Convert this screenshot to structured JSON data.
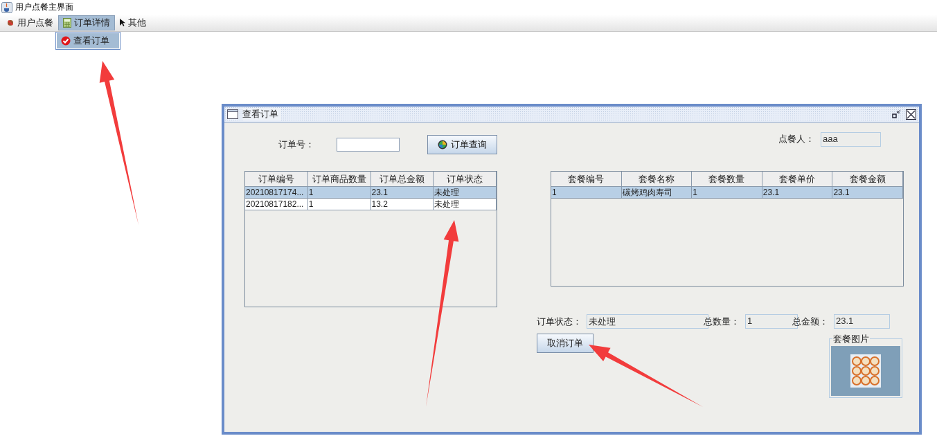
{
  "window": {
    "title": "用户点餐主界面"
  },
  "menu": [
    {
      "label": "用户点餐",
      "selected": false
    },
    {
      "label": "订单详情",
      "selected": true
    },
    {
      "label": "其他",
      "selected": false
    }
  ],
  "dropdown": [
    {
      "label": "查看订单",
      "selected": true
    }
  ],
  "dialog": {
    "title": "查看订单",
    "order_no": {
      "label": "订单号："
    },
    "query_button": "订单查询",
    "customer": {
      "label": "点餐人：",
      "value": "aaa"
    },
    "orders_table": {
      "columns": [
        "订单编号",
        "订单商品数量",
        "订单总金额",
        "订单状态"
      ],
      "rows": [
        {
          "cells": [
            "20210817174...",
            "1",
            "23.1",
            "未处理"
          ],
          "selected": true
        },
        {
          "cells": [
            "20210817182...",
            "1",
            "13.2",
            "未处理"
          ],
          "selected": false
        }
      ]
    },
    "items_table": {
      "columns": [
        "套餐编号",
        "套餐名称",
        "套餐数量",
        "套餐单价",
        "套餐金额"
      ],
      "rows": [
        {
          "cells": [
            "1",
            "碳烤鸡肉寿司",
            "1",
            "23.1",
            "23.1"
          ],
          "selected": true
        }
      ]
    },
    "summary": [
      {
        "label": "订单状态：",
        "value": "未处理"
      },
      {
        "label": "总数量：",
        "value": "1"
      },
      {
        "label": "总金额：",
        "value": "23.1"
      }
    ],
    "cancel_button": "取消订单",
    "picture_group": {
      "title": "套餐图片"
    }
  }
}
